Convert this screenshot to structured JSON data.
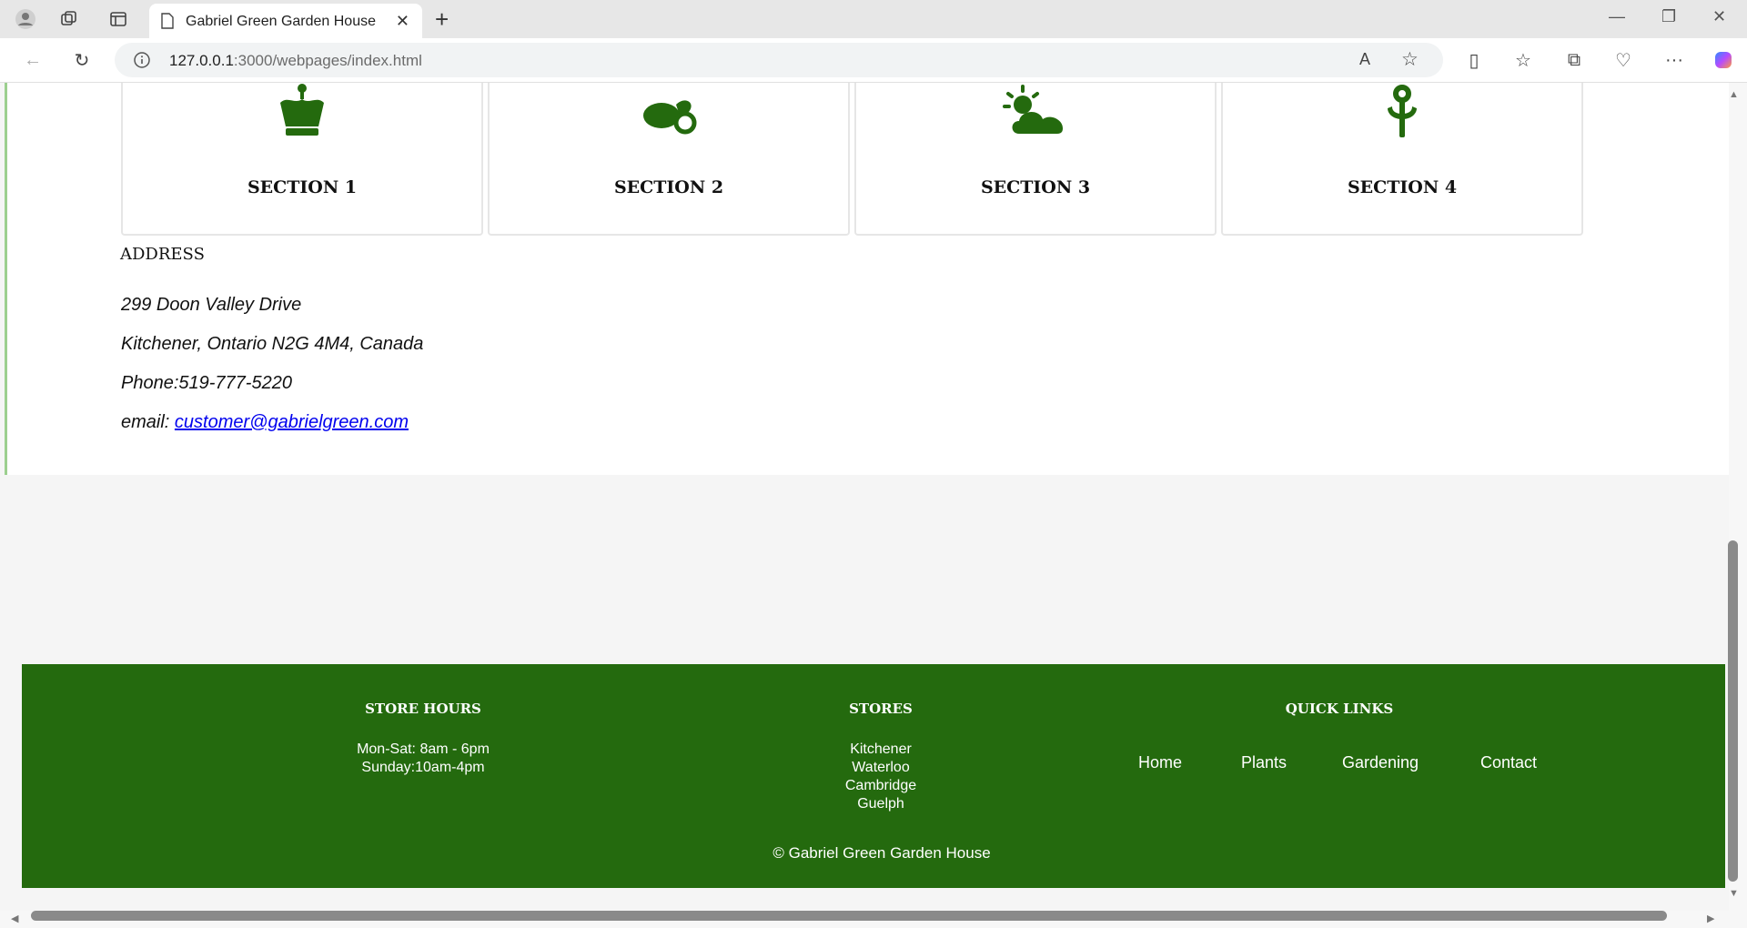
{
  "browser": {
    "tab_title": "Gabriel Green Garden House",
    "url_host": "127.0.0.1",
    "url_rest": ":3000/webpages/index.html"
  },
  "sections": [
    {
      "label": "SECTION 1",
      "icon": "crown-icon"
    },
    {
      "label": "SECTION 2",
      "icon": "watering-can-icon"
    },
    {
      "label": "SECTION 3",
      "icon": "sun-cloud-icon"
    },
    {
      "label": "SECTION 4",
      "icon": "sprout-icon"
    }
  ],
  "address": {
    "title": "ADDRESS",
    "street": "299 Doon Valley Drive",
    "city": "Kitchener, Ontario N2G 4M4, Canada",
    "phone": "Phone:519-777-5220",
    "email_label": "email:",
    "email": "customer@gabrielgreen.com"
  },
  "footer": {
    "store_hours_title": "STORE HOURS",
    "hours": [
      "Mon-Sat: 8am - 6pm",
      "Sunday:10am-4pm"
    ],
    "stores_title": "STORES",
    "stores": [
      "Kitchener",
      "Waterloo",
      "Cambridge",
      "Guelph"
    ],
    "quick_links_title": "QUICK LINKS",
    "links": [
      "Home",
      "Plants",
      "Gardening",
      "Contact"
    ],
    "copyright": "© Gabriel Green Garden House"
  },
  "colors": {
    "brand_green": "#246a0e",
    "footer_text": "#ffffff"
  }
}
